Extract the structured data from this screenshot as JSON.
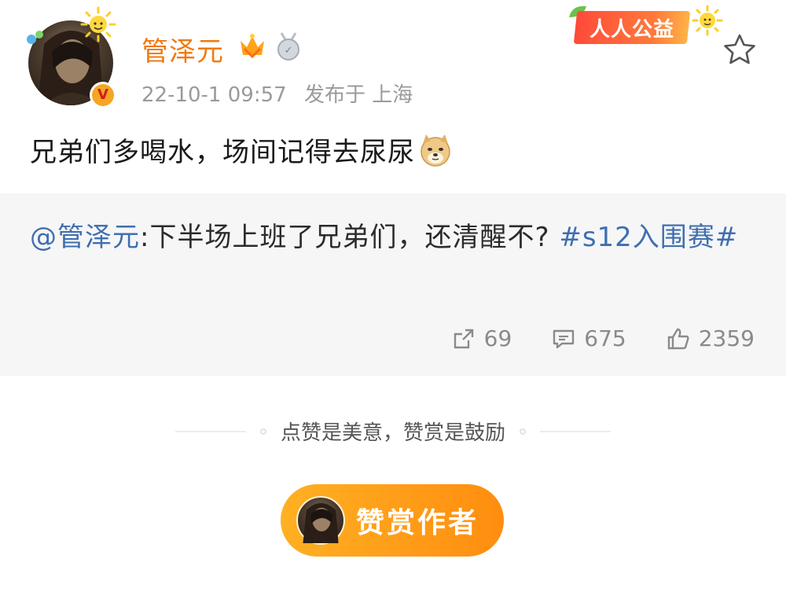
{
  "post": {
    "author": {
      "name": "管泽元",
      "verified_mark": "V"
    },
    "date": "22-10-1 09:57",
    "location": "发布于 上海",
    "text": "兄弟们多喝水，场间记得去尿尿",
    "emoji": "doge-icon",
    "badge_label": "人人公益"
  },
  "repost": {
    "mention": "@管泽元",
    "colon": ":",
    "text": "下半场上班了兄弟们，还清醒不?",
    "hashtag": "#s12入围赛#"
  },
  "stats": {
    "reposts": "69",
    "comments": "675",
    "likes": "2359"
  },
  "reward": {
    "caption": "点赞是美意，赞赏是鼓励",
    "button_label": "赞赏作者"
  },
  "colors": {
    "username": "#f07a12",
    "link": "#3f6fb0",
    "reward_button": "#ff9a1a",
    "repost_background": "#f6f6f6"
  }
}
